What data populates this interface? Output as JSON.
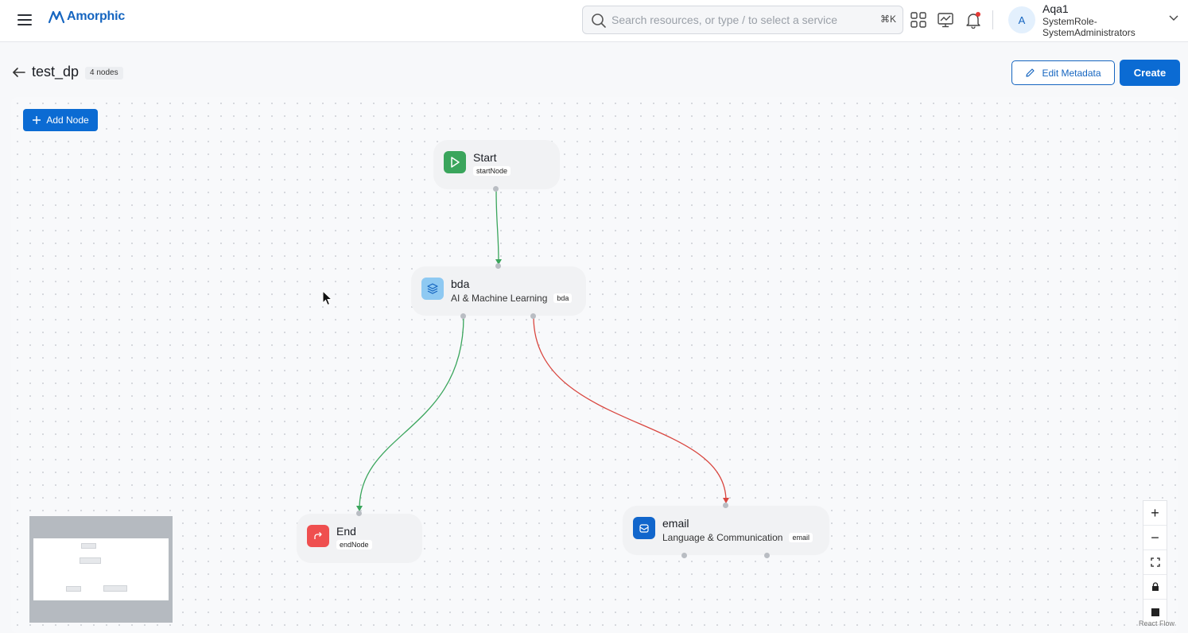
{
  "header": {
    "logo_text": "Amorphic",
    "search_placeholder": "Search resources, or type / to select a service",
    "search_shortcut": "⌘K",
    "icons": [
      "apps-grid-icon",
      "monitor-chart-icon",
      "bell-icon"
    ],
    "user": {
      "avatar_letter": "A",
      "name": "Aqa1",
      "role": "SystemRole-SystemAdministrators"
    }
  },
  "page": {
    "title": "test_dp",
    "node_count": "4 nodes",
    "edit_metadata_label": "Edit Metadata",
    "create_label": "Create"
  },
  "canvas": {
    "add_node_label": "Add Node",
    "nodes": {
      "start": {
        "title": "Start",
        "type_tag": "startNode",
        "icon": "play-icon",
        "color": "#3aa55c"
      },
      "bda": {
        "title": "bda",
        "category": "AI & Machine Learning",
        "type_tag": "bda",
        "icon": "layers-icon",
        "color": "#8ec9f2"
      },
      "end": {
        "title": "End",
        "type_tag": "endNode",
        "icon": "exit-icon",
        "color": "#ef4f4f"
      },
      "email": {
        "title": "email",
        "category": "Language & Communication",
        "type_tag": "email",
        "icon": "mail-icon",
        "color": "#1166cc"
      }
    },
    "edges": [
      {
        "from": "Start",
        "to": "bda",
        "color": "#3aa55c"
      },
      {
        "from": "bda",
        "to": "End",
        "color": "#3aa55c"
      },
      {
        "from": "bda",
        "to": "email",
        "color": "#d9463f"
      }
    ],
    "controls": [
      "zoom-in",
      "zoom-out",
      "fit-view",
      "lock",
      "toggle-interactivity"
    ],
    "attribution": "React Flow"
  }
}
